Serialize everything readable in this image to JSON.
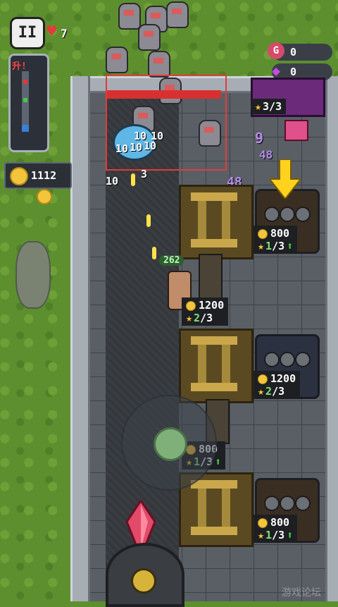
{
  "hud": {
    "pause_label": "II",
    "lives": "7",
    "gold": "1112",
    "gems_g": "0",
    "gems_purple": "0",
    "g_icon_label": "G"
  },
  "minimap": {
    "label": "升!"
  },
  "enemy_gate": {
    "progress": "3/3"
  },
  "damage_numbers": [
    "10",
    "10",
    "10",
    "10",
    "10",
    "10",
    "3"
  ],
  "floating_numbers": {
    "top_right": "48",
    "gate_left": "9",
    "gate_low": "48"
  },
  "hero": {
    "hp": "262"
  },
  "towers": [
    {
      "id": "slot-a",
      "cost": "800",
      "level": "1",
      "max": "/3",
      "upgradable": true,
      "style": "brown"
    },
    {
      "id": "slot-b",
      "cost": "1200",
      "level": "2",
      "max": "/3",
      "upgradable": false,
      "style": "blue"
    },
    {
      "id": "slot-c",
      "cost": "800",
      "level": "1",
      "max": "/3",
      "upgradable": true,
      "style": "brown"
    },
    {
      "id": "lane-1",
      "cost": "1200",
      "level": "2",
      "max": "/3",
      "upgradable": false
    },
    {
      "id": "lane-2",
      "cost": "800",
      "level": "1",
      "max": "/3",
      "upgradable": true
    }
  ],
  "watermark": "游戏论坛",
  "colors": {
    "accent_gold": "#f2c53d",
    "hp_red": "#d83030",
    "upgrade_green": "#4fd04f"
  }
}
